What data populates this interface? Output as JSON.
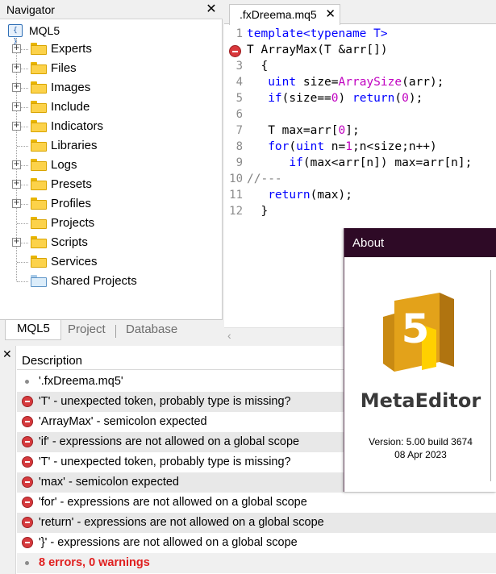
{
  "navigator": {
    "title": "Navigator",
    "close_icon": "close-icon",
    "root": "MQL5",
    "items": [
      {
        "label": "Experts",
        "expandable": true,
        "icon": "folder-icon"
      },
      {
        "label": "Files",
        "expandable": true,
        "icon": "folder-icon"
      },
      {
        "label": "Images",
        "expandable": true,
        "icon": "folder-icon"
      },
      {
        "label": "Include",
        "expandable": true,
        "icon": "folder-icon"
      },
      {
        "label": "Indicators",
        "expandable": true,
        "icon": "folder-icon"
      },
      {
        "label": "Libraries",
        "expandable": false,
        "icon": "folder-icon"
      },
      {
        "label": "Logs",
        "expandable": true,
        "icon": "folder-icon"
      },
      {
        "label": "Presets",
        "expandable": true,
        "icon": "folder-icon"
      },
      {
        "label": "Profiles",
        "expandable": true,
        "icon": "folder-icon"
      },
      {
        "label": "Projects",
        "expandable": false,
        "icon": "folder-icon"
      },
      {
        "label": "Scripts",
        "expandable": true,
        "icon": "folder-icon"
      },
      {
        "label": "Services",
        "expandable": false,
        "icon": "folder-icon"
      },
      {
        "label": "Shared Projects",
        "expandable": false,
        "icon": "shared-folder-icon"
      }
    ],
    "tabs": [
      "MQL5",
      "Project",
      "Database"
    ],
    "active_tab": "MQL5"
  },
  "editor": {
    "tab_label": ".fxDreema.mq5",
    "tab_close": "✕",
    "lines": [
      {
        "num": "1",
        "error": false,
        "tokens": [
          {
            "t": "template<typename T>",
            "c": "kw"
          }
        ]
      },
      {
        "num": "2",
        "error": true,
        "tokens": [
          {
            "t": "T ArrayMax(T &arr[])",
            "c": ""
          }
        ]
      },
      {
        "num": "3",
        "error": false,
        "tokens": [
          {
            "t": "  {",
            "c": ""
          }
        ]
      },
      {
        "num": "4",
        "error": false,
        "tokens": [
          {
            "t": "   ",
            "c": ""
          },
          {
            "t": "uint",
            "c": "kw"
          },
          {
            "t": " size=",
            "c": ""
          },
          {
            "t": "ArraySize",
            "c": "fn"
          },
          {
            "t": "(arr);",
            "c": ""
          }
        ]
      },
      {
        "num": "5",
        "error": false,
        "tokens": [
          {
            "t": "   ",
            "c": ""
          },
          {
            "t": "if",
            "c": "kw"
          },
          {
            "t": "(size==",
            "c": ""
          },
          {
            "t": "0",
            "c": "num"
          },
          {
            "t": ") ",
            "c": ""
          },
          {
            "t": "return",
            "c": "kw"
          },
          {
            "t": "(",
            "c": ""
          },
          {
            "t": "0",
            "c": "num"
          },
          {
            "t": ");",
            "c": ""
          }
        ]
      },
      {
        "num": "6",
        "error": false,
        "tokens": []
      },
      {
        "num": "7",
        "error": false,
        "tokens": [
          {
            "t": "   T max=arr[",
            "c": ""
          },
          {
            "t": "0",
            "c": "num"
          },
          {
            "t": "];",
            "c": ""
          }
        ]
      },
      {
        "num": "8",
        "error": false,
        "tokens": [
          {
            "t": "   ",
            "c": ""
          },
          {
            "t": "for",
            "c": "kw"
          },
          {
            "t": "(",
            "c": ""
          },
          {
            "t": "uint",
            "c": "kw"
          },
          {
            "t": " n=",
            "c": ""
          },
          {
            "t": "1",
            "c": "num"
          },
          {
            "t": ";n<size;n++)",
            "c": ""
          }
        ]
      },
      {
        "num": "9",
        "error": false,
        "tokens": [
          {
            "t": "      ",
            "c": ""
          },
          {
            "t": "if",
            "c": "kw"
          },
          {
            "t": "(max<arr[n]) max=arr[n];",
            "c": ""
          }
        ]
      },
      {
        "num": "10",
        "error": false,
        "tokens": [
          {
            "t": "//---",
            "c": "cmt"
          }
        ]
      },
      {
        "num": "11",
        "error": false,
        "tokens": [
          {
            "t": "   ",
            "c": ""
          },
          {
            "t": "return",
            "c": "kw"
          },
          {
            "t": "(max);",
            "c": ""
          }
        ]
      },
      {
        "num": "12",
        "error": false,
        "tokens": [
          {
            "t": "  }",
            "c": ""
          }
        ]
      }
    ]
  },
  "errors": {
    "close_label": "✕",
    "header": "Description",
    "rows": [
      {
        "type": "info",
        "text": "'.fxDreema.mq5'"
      },
      {
        "type": "error",
        "text": "'T' - unexpected token, probably type is missing?"
      },
      {
        "type": "error",
        "text": "'ArrayMax' - semicolon expected"
      },
      {
        "type": "error",
        "text": "'if' - expressions are not allowed on a global scope"
      },
      {
        "type": "error",
        "text": "'T' - unexpected token, probably type is missing?"
      },
      {
        "type": "error",
        "text": "'max' - semicolon expected"
      },
      {
        "type": "error",
        "text": "'for' - expressions are not allowed on a global scope"
      },
      {
        "type": "error",
        "text": "'return' - expressions are not allowed on a global scope"
      },
      {
        "type": "error",
        "text": "'}' - expressions are not allowed on a global scope"
      }
    ],
    "summary": "8 errors, 0 warnings"
  },
  "about": {
    "title": "About",
    "logo_digit": "5",
    "product": "MetaEditor",
    "version": "Version: 5.00 build 3674",
    "date": "08 Apr 2023"
  },
  "colors": {
    "keyword": "#0000ff",
    "function": "#c000c0",
    "error": "#d9373b",
    "about_titlebar": "#2e0a26",
    "summary_text": "#e02020"
  }
}
